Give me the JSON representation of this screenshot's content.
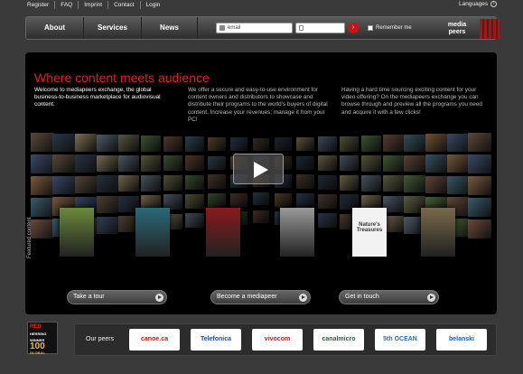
{
  "top_links": [
    "Register",
    "FAQ",
    "Imprint",
    "Contact",
    "Login"
  ],
  "languages_label": "Languages",
  "nav": {
    "about": "About",
    "services": "Services",
    "news": "News"
  },
  "login": {
    "email_placeholder": "email",
    "remember_label": "Remember me"
  },
  "logo": {
    "line1": "media",
    "line2": "peers"
  },
  "main": {
    "headline": "Where content meets audience",
    "col1": "Welcome to mediapeers exchange, the global business-to-business marketplace for audiovisual content.",
    "col2": "We offer a secure and easy-to-use environment for content owners and distributors to showcase and distribute their programs to the world's buyers of digital content. Increase your revenues; manage it from your PC!",
    "col3": "Having a hard time sourcing exciting content for your video offering? On the mediapeers exchange you can browse through and preview all the programs you need and acquire it with a few clicks!",
    "featured_label": "Featured content"
  },
  "posters": [
    {
      "title": "",
      "color": "#6a8a3a"
    },
    {
      "title": "",
      "color": "#2a6a7a"
    },
    {
      "title": "",
      "color": "#8a1a1a"
    },
    {
      "title": "",
      "color": "#9a9a9a"
    },
    {
      "title": "Nature's Treasures",
      "color": "#f0f0f0"
    },
    {
      "title": "",
      "color": "#7a6a4a"
    }
  ],
  "cta": {
    "tour": "Take a tour",
    "become": "Become a mediapeer",
    "contact": "Get in touch"
  },
  "footer": {
    "award": {
      "line1": "RED",
      "line2": "HERRING",
      "line3": "WINNER",
      "line4": "100",
      "line5": "GLOBAL"
    },
    "peers_label": "Our peers",
    "peers": [
      {
        "name": "canoe.ca",
        "color": "#d01010"
      },
      {
        "name": "Telefonica",
        "color": "#1a4aa0"
      },
      {
        "name": "vivocom",
        "color": "#d01010"
      },
      {
        "name": "canalmicro",
        "color": "#1a6a3a"
      },
      {
        "name": "5th OCEAN",
        "color": "#2a6ab0"
      },
      {
        "name": "belanski",
        "color": "#1a5ab0"
      }
    ]
  },
  "colors": {
    "accent": "#e02020",
    "background": "#3a3a3a",
    "panel": "#000000"
  }
}
